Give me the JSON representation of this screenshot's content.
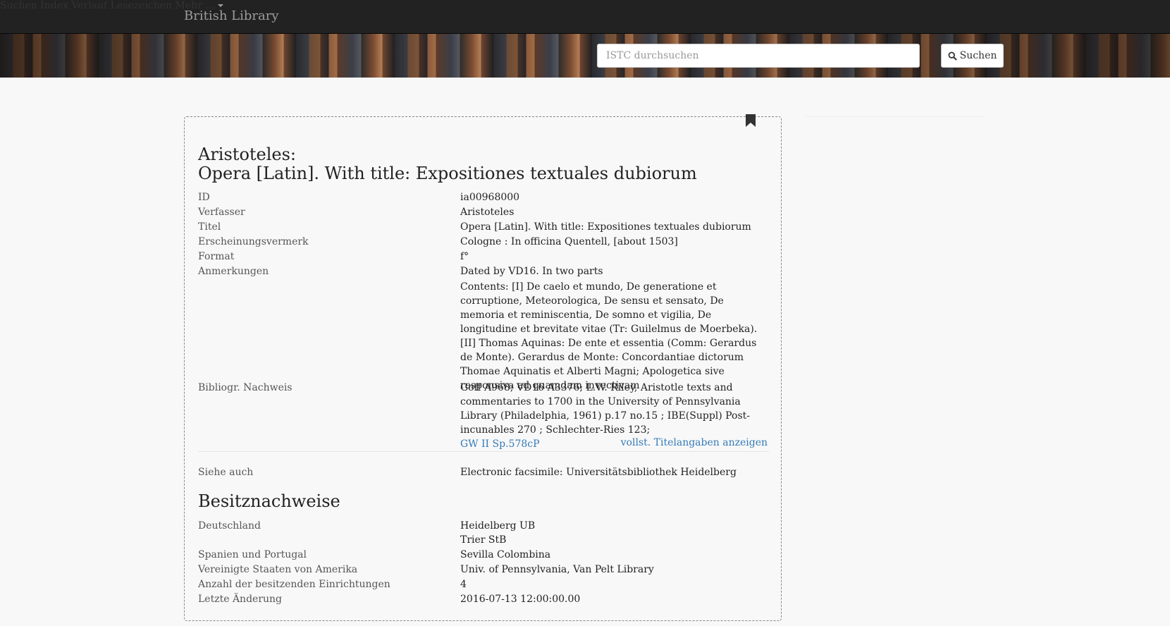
{
  "brand": "British Library",
  "nav": {
    "items": [
      "Suchen",
      "Index",
      "Verlauf",
      "Lesezeichen"
    ],
    "more": "Mehr ..."
  },
  "search": {
    "placeholder": "ISTC durchsuchen",
    "button_label": "Suchen"
  },
  "record": {
    "author": "Aristoteles:",
    "title": "Opera [Latin]. With title: Expositiones textuales dubiorum",
    "fields": [
      {
        "label": "ID",
        "value": "ia00968000"
      },
      {
        "label": "Verfasser",
        "value": "Aristoteles"
      },
      {
        "label": "Titel",
        "value": "Opera [Latin]. With title: Expositiones textuales dubiorum"
      },
      {
        "label": "Erscheinungsvermerk",
        "value": "Cologne : In officina Quentell, [about 1503]"
      },
      {
        "label": "Format",
        "value": "f°"
      },
      {
        "label": "Anmerkungen",
        "value": "Dated by VD16. In two parts"
      },
      {
        "label": "",
        "value": "Contents: [I] De caelo et mundo, De generatione et corruptione, Meteorologica, De sensu et sensato, De memoria et reminiscentia, De somno et vigilia, De longitudine et brevitate vitae (Tr: Guilelmus de Moerbeka). [II] Thomas Aquinas: De ente et essentia (Comm: Gerardus de Monte). Gerardus de Monte: Concordantiae dictorum Thomae Aquinatis et Alberti Magni; Apologetica sive responsiva ad quamdam invectivam"
      },
      {
        "label": "Bibliogr. Nachweis",
        "value": "Goff A968; VD16 A3376; L.W. Riley, Aristotle texts and commentaries to 1700 in the University of Pennsylvania Library (Philadelphia, 1961) p.17 no.15 ; IBE(Suppl) Post-incunables 270 ; Schlechter-Ries 123;",
        "link": "GW II Sp.578cP"
      }
    ],
    "full_details_link": "vollst. Titelangaben anzeigen",
    "see_also": {
      "label": "Siehe auch",
      "value": "Electronic facsimile: Universitätsbibliothek Heidelberg"
    },
    "holdings_heading": "Besitznachweise",
    "holdings": [
      {
        "label": "Deutschland",
        "value": "Heidelberg UB"
      },
      {
        "label": "",
        "value": "Trier StB"
      },
      {
        "label": "Spanien und Portugal",
        "value": "Sevilla Colombina"
      },
      {
        "label": "Vereinigte Staaten von Amerika",
        "value": "Univ. of Pennsylvania, Van Pelt Library"
      },
      {
        "label": "Anzahl der besitzenden Einrichtungen",
        "value": "4"
      },
      {
        "label": "Letzte Änderung",
        "value": "2016-07-13 12:00:00.00"
      }
    ]
  }
}
